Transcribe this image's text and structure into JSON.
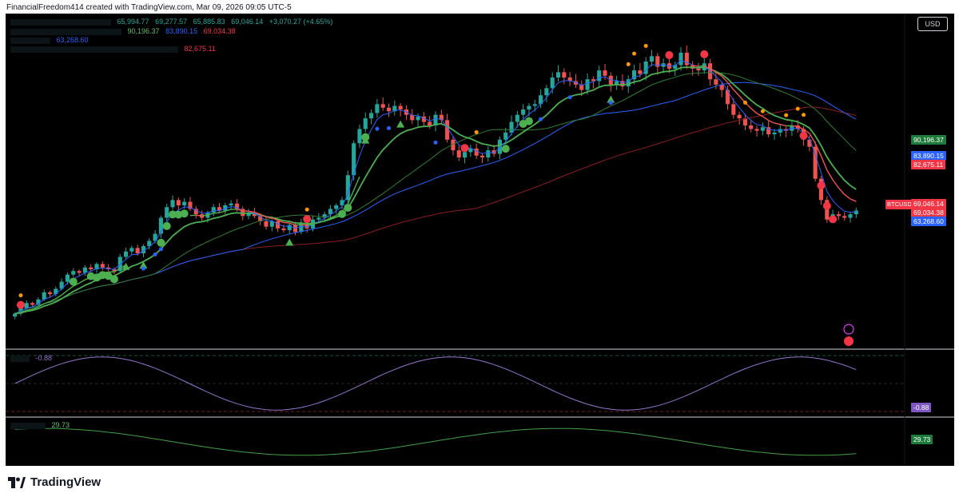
{
  "header": {
    "author_line": "FinancialFreedom414 created with TradingView.com, Mar 09, 2026 09:05 UTC-5"
  },
  "legend": {
    "ohlc": {
      "open": "65,994.77",
      "high": "69,277.57",
      "low": "65,885.83",
      "close": "69,046.14",
      "change": "+3,070.27 (+4.65%)"
    },
    "ma_values": {
      "v1": "90,196.37",
      "v2": "83,890.15",
      "v3": "69,034.38"
    },
    "ma_long": "63,268.60",
    "line4_value": "82,675.11",
    "oscillator_value": "-0.88",
    "rsi_value": "29.73"
  },
  "toolbar": {
    "currency": "USD"
  },
  "price_scale": {
    "labels": [
      {
        "text": "90,196.37",
        "color": "#1e7a3a"
      },
      {
        "text": "83,890.15",
        "color": "#2962ff"
      },
      {
        "text": "82,675.11",
        "color": "#f23645"
      },
      {
        "text": "69,046.14",
        "color": "#f23645"
      },
      {
        "text": "69,034.38",
        "color": "#f23645"
      },
      {
        "text": "63,268.60",
        "color": "#2962ff"
      }
    ],
    "symbol": "BTCUSD",
    "oscillator_label": "-0.88",
    "oscillator_color": "#7e57c2",
    "rsi_label": "29.73",
    "rsi_color": "#1e7a3a"
  },
  "colors": {
    "bull": "#26a69a",
    "bear": "#ef5350",
    "ema_fast": "#4caf50",
    "ema_slow": "#ef5350",
    "ma_blue": "#2962ff",
    "ma_green_dark": "#2e7d32",
    "osc_line": "#9575cd",
    "rsi_line": "#43a047"
  },
  "brand": {
    "name": "TradingView"
  },
  "chart_data": {
    "type": "candlestick",
    "symbol": "BTCUSD",
    "currency": "USD",
    "last_price": 69046.14,
    "ohlc_last": {
      "open": 65994.77,
      "high": 69277.57,
      "low": 65885.83,
      "close": 69046.14
    },
    "moving_averages": [
      {
        "value": 90196.37
      },
      {
        "value": 83890.15
      },
      {
        "value": 82675.11
      },
      {
        "value": 69034.38
      },
      {
        "value": 63268.6
      }
    ],
    "closes": [
      40000,
      41500,
      43000,
      42500,
      44000,
      46000,
      45500,
      47000,
      49000,
      51000,
      52000,
      51500,
      53000,
      52500,
      54000,
      53000,
      52500,
      52000,
      56000,
      57500,
      58500,
      57000,
      59000,
      60500,
      62500,
      67000,
      70000,
      72000,
      70500,
      71500,
      69500,
      68000,
      67000,
      68500,
      70000,
      69000,
      70500,
      71000,
      69500,
      67500,
      68500,
      67500,
      66000,
      64500,
      66000,
      64000,
      63500,
      65000,
      63000,
      65500,
      64000,
      66500,
      67000,
      68000,
      69500,
      70500,
      72000,
      79000,
      88000,
      92000,
      95000,
      96500,
      99000,
      98000,
      97000,
      98500,
      97500,
      96000,
      94500,
      95500,
      94000,
      93000,
      96000,
      94500,
      89000,
      86000,
      84000,
      85500,
      86500,
      84500,
      84000,
      86000,
      85000,
      89000,
      91000,
      94000,
      96000,
      97500,
      98500,
      99000,
      101500,
      103500,
      106500,
      108000,
      106500,
      105500,
      104500,
      103000,
      106000,
      105500,
      108500,
      107000,
      104500,
      105500,
      104000,
      106000,
      108500,
      107500,
      111000,
      112500,
      109500,
      110500,
      109000,
      110000,
      113500,
      110000,
      109000,
      108500,
      110500,
      106000,
      104500,
      103000,
      99000,
      96000,
      95000,
      93000,
      92000,
      91500,
      92500,
      90500,
      91000,
      92000,
      91500,
      93000,
      92000,
      89000,
      87000,
      78000,
      72000,
      66500,
      68000,
      67500,
      67000,
      68000,
      69046
    ],
    "oscillator": {
      "value": -0.88,
      "levels": [
        0.88,
        0,
        -0.88
      ]
    },
    "rsi": {
      "value": 29.73
    }
  }
}
